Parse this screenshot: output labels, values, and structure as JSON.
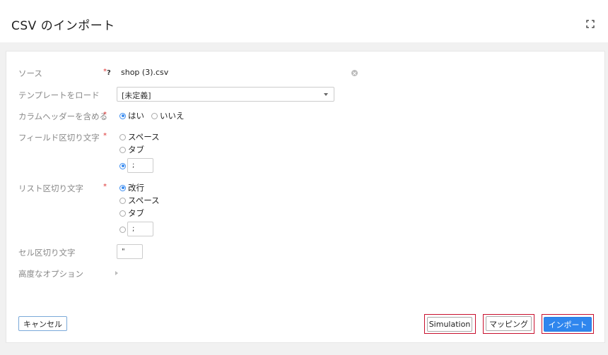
{
  "header": {
    "title": "CSV のインポート",
    "expand_icon": "expand-icon"
  },
  "form": {
    "source": {
      "label": "ソース",
      "required_mark": "*",
      "help_mark": "?",
      "value": "shop (3).csv",
      "clear_icon": "clear-icon"
    },
    "template": {
      "label": "テンプレートをロード",
      "selected": "[未定義]"
    },
    "column_header": {
      "label": "カラムヘッダーを含める",
      "required_mark": "*",
      "options": [
        "はい",
        "いいえ"
      ],
      "selected_index": 0
    },
    "field_delimiter": {
      "label": "フィールド区切り文字",
      "required_mark": "*",
      "options": [
        "スペース",
        "タブ"
      ],
      "custom_value": ";",
      "selected": "custom"
    },
    "list_delimiter": {
      "label": "リスト区切り文字",
      "required_mark": "*",
      "options": [
        "改行",
        "スペース",
        "タブ"
      ],
      "custom_value": ";",
      "selected_index": 0
    },
    "cell_delimiter": {
      "label": "セル区切り文字",
      "value": "\""
    },
    "advanced": {
      "label": "高度なオプション"
    }
  },
  "footer": {
    "cancel_label": "キャンセル",
    "simulation_label": "Simulation",
    "mapping_label": "マッピング",
    "import_label": "インポート"
  },
  "colors": {
    "accent": "#2f86ee",
    "required": "#d33333",
    "highlight": "#c8102e"
  }
}
